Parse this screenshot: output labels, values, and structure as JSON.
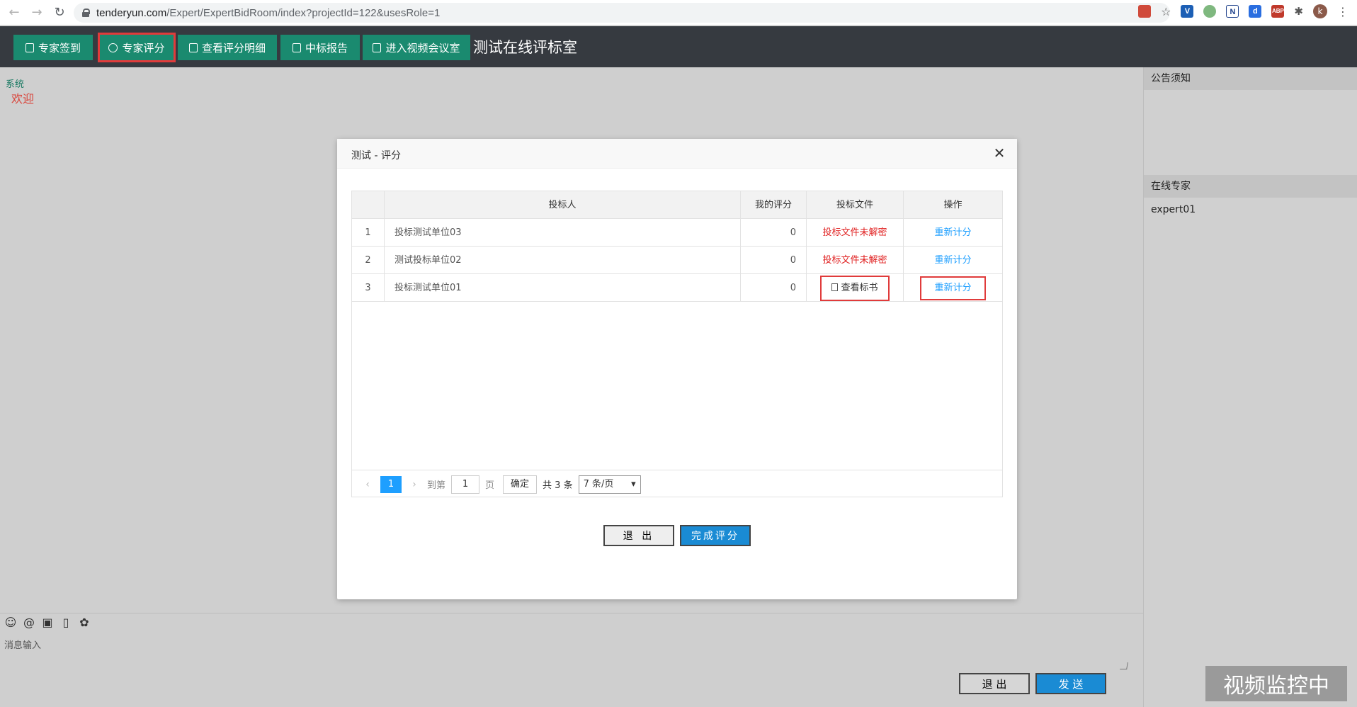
{
  "browser": {
    "url_host": "tenderyun.com",
    "url_path": "/Expert/ExpertBidRoom/index?projectId=122&usesRole=1",
    "avatar_letter": "k"
  },
  "topbar": {
    "buttons": [
      {
        "label": "专家签到",
        "icon": "checkin-icon"
      },
      {
        "label": "专家评分",
        "icon": "score-icon"
      },
      {
        "label": "查看评分明细",
        "icon": "document-icon"
      },
      {
        "label": "中标报告",
        "icon": "report-icon"
      },
      {
        "label": "进入视频会议室",
        "icon": "video-icon"
      }
    ],
    "title": "测试在线评标室"
  },
  "chat": {
    "system_label": "系统",
    "welcome": "欢迎",
    "message_placeholder": "消息输入",
    "exit_label": "退 出",
    "send_label": "发 送"
  },
  "right_panel": {
    "notice_header": "公告须知",
    "experts_header": "在线专家",
    "experts": [
      "expert01"
    ],
    "watermark": "视频监控中"
  },
  "modal": {
    "title": "测试 - 评分",
    "columns": [
      "",
      "投标人",
      "我的评分",
      "投标文件",
      "操作"
    ],
    "rows": [
      {
        "index": "1",
        "bidder": "投标测试单位03",
        "score": "0",
        "file": "投标文件未解密",
        "action": "重新计分"
      },
      {
        "index": "2",
        "bidder": "测试投标单位02",
        "score": "0",
        "file": "投标文件未解密",
        "action": "重新计分"
      },
      {
        "index": "3",
        "bidder": "投标测试单位01",
        "score": "0",
        "file": "查看标书",
        "action": "重新计分"
      }
    ],
    "pager": {
      "current_page": "1",
      "goto_label": "到第",
      "goto_value": "1",
      "page_suffix": "页",
      "confirm": "确定",
      "total": "共 3 条",
      "page_size": "7 条/页"
    },
    "exit_label": "退 出",
    "finish_label": "完成评分"
  }
}
